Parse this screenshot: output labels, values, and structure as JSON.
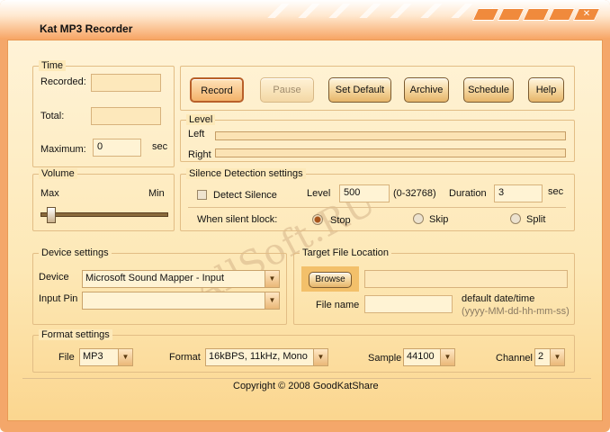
{
  "window": {
    "title": "Kat MP3 Recorder",
    "close_glyph": "✕"
  },
  "time": {
    "legend": "Time",
    "recorded_label": "Recorded:",
    "recorded_value": "",
    "total_label": "Total:",
    "total_value": "",
    "maximum_label": "Maximum:",
    "maximum_value": "0",
    "unit": "sec"
  },
  "toolbar": {
    "record": "Record",
    "pause": "Pause",
    "set_default": "Set Default",
    "archive": "Archive",
    "schedule": "Schedule",
    "help": "Help"
  },
  "level": {
    "legend": "Level",
    "left_label": "Left",
    "right_label": "Right",
    "left_fill": 0,
    "right_fill": 0
  },
  "volume": {
    "legend": "Volume",
    "max_label": "Max",
    "min_label": "Min",
    "position": 0.05
  },
  "silence": {
    "legend": "Silence Detection settings",
    "detect_label": "Detect Silence",
    "detect_checked": false,
    "level_label": "Level",
    "level_value": "500",
    "level_range": "(0-32768)",
    "duration_label": "Duration",
    "duration_value": "3",
    "unit": "sec",
    "when_label": "When silent block:",
    "options": [
      "Stop",
      "Skip",
      "Split"
    ],
    "selected": "Stop"
  },
  "device": {
    "legend": "Device settings",
    "device_label": "Device",
    "device_value": "Microsoft Sound Mapper - Input",
    "input_pin_label": "Input Pin",
    "input_pin_value": ""
  },
  "target": {
    "legend": "Target File Location",
    "browse": "Browse",
    "path_value": "",
    "file_name_label": "File name",
    "file_name_value": "",
    "hint": "default date/time",
    "hint_format": "(yyyy-MM-dd-hh-mm-ss)"
  },
  "format": {
    "legend": "Format settings",
    "file_label": "File",
    "file_value": "MP3",
    "format_label": "Format",
    "format_value": "16kBPS, 11kHz, Mono",
    "sample_label": "Sample",
    "sample_value": "44100",
    "channel_label": "Channel",
    "channel_value": "2"
  },
  "footer": {
    "copyright": "Copyright © 2008 GoodKatShare"
  },
  "watermark": "AllSoft.RU",
  "colors": {
    "accent": "#f08a3c",
    "panel": "#fde8b6",
    "border": "#e2bd85"
  }
}
